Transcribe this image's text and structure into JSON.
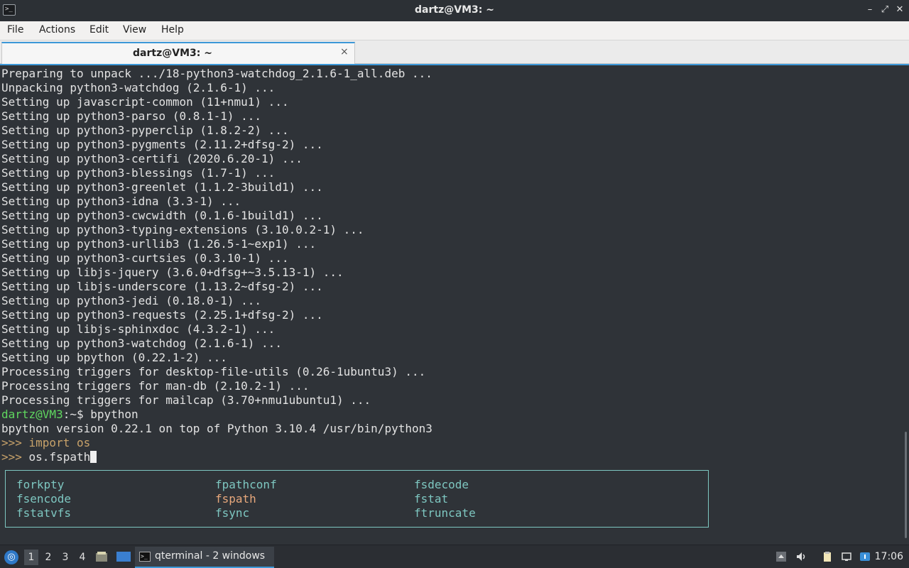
{
  "window": {
    "title": "dartz@VM3: ~",
    "app_icon_glyph": ">_",
    "controls": {
      "minimize": "–",
      "maximize": "⤢",
      "close": "✕"
    }
  },
  "menu": [
    "File",
    "Actions",
    "Edit",
    "View",
    "Help"
  ],
  "tab": {
    "label": "dartz@VM3: ~",
    "close": "×"
  },
  "terminal": {
    "output_lines": [
      "Preparing to unpack .../18-python3-watchdog_2.1.6-1_all.deb ...",
      "Unpacking python3-watchdog (2.1.6-1) ...",
      "Setting up javascript-common (11+nmu1) ...",
      "Setting up python3-parso (0.8.1-1) ...",
      "Setting up python3-pyperclip (1.8.2-2) ...",
      "Setting up python3-pygments (2.11.2+dfsg-2) ...",
      "Setting up python3-certifi (2020.6.20-1) ...",
      "Setting up python3-blessings (1.7-1) ...",
      "Setting up python3-greenlet (1.1.2-3build1) ...",
      "Setting up python3-idna (3.3-1) ...",
      "Setting up python3-cwcwidth (0.1.6-1build1) ...",
      "Setting up python3-typing-extensions (3.10.0.2-1) ...",
      "Setting up python3-urllib3 (1.26.5-1~exp1) ...",
      "Setting up python3-curtsies (0.3.10-1) ...",
      "Setting up libjs-jquery (3.6.0+dfsg+~3.5.13-1) ...",
      "Setting up libjs-underscore (1.13.2~dfsg-2) ...",
      "Setting up python3-jedi (0.18.0-1) ...",
      "Setting up python3-requests (2.25.1+dfsg-2) ...",
      "Setting up libjs-sphinxdoc (4.3.2-1) ...",
      "Setting up python3-watchdog (2.1.6-1) ...",
      "Setting up bpython (0.22.1-2) ...",
      "Processing triggers for desktop-file-utils (0.26-1ubuntu3) ...",
      "Processing triggers for man-db (2.10.2-1) ...",
      "Processing triggers for mailcap (3.70+nmu1ubuntu1) ..."
    ],
    "shell_prompt": "dartz@VM3",
    "shell_prompt_suffix": ":~$ ",
    "shell_command": "bpython",
    "bpython_banner": "bpython version 0.22.1 on top of Python 3.10.4 /usr/bin/python3",
    "repl_prompt": ">>> ",
    "repl_line1": "import os",
    "repl_line2": "os.fspath",
    "completions": [
      [
        "forkpty",
        "fpathconf",
        "fsdecode"
      ],
      [
        "fsencode",
        "fspath",
        "fstat"
      ],
      [
        "fstatvfs",
        "fsync",
        "ftruncate"
      ]
    ],
    "selected_completion": "fspath"
  },
  "taskbar": {
    "start_glyph": "◎",
    "workspaces": [
      "1",
      "2",
      "3",
      "4"
    ],
    "active_workspace": "1",
    "task_label": "qterminal - 2 windows",
    "clock": "17:06"
  },
  "colors": {
    "accent": "#3c98d8",
    "prompt_green": "#5fd75f",
    "completion_teal": "#7ec7c1",
    "completion_selected": "#e8a87c",
    "terminal_bg": "#2f3338"
  }
}
